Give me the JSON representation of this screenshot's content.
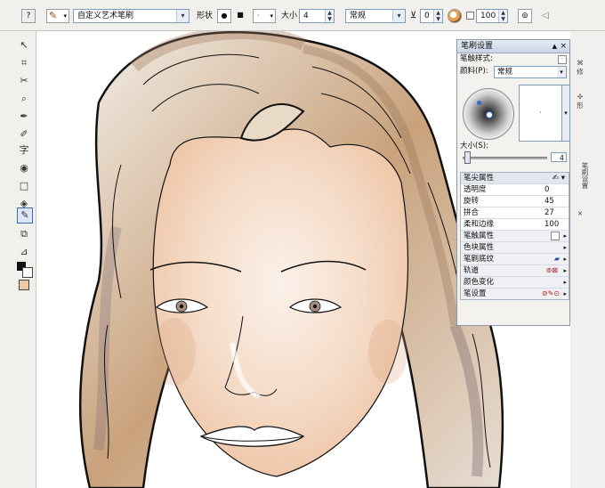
{
  "toolbar": {
    "brush_name": "自定义艺术笔刷",
    "shape_label": "形状",
    "size_label": "大小",
    "size_value": "4",
    "mode_value": "常规",
    "transparency_value": "0",
    "opacity_value": "100"
  },
  "panel": {
    "title": "笔刷设置",
    "nib_style_label": "笔触样式:",
    "paint_label": "颜料(P):",
    "paint_value": "常规",
    "size_label": "大小(S):",
    "size_value": "4",
    "nib_header": "笔尖属性",
    "properties": [
      {
        "label": "透明度",
        "value": "0"
      },
      {
        "label": "旋转",
        "value": "45"
      },
      {
        "label": "拼合",
        "value": "27"
      },
      {
        "label": "柔和边缘",
        "value": "100"
      }
    ],
    "sections": [
      {
        "label": "笔触属性"
      },
      {
        "label": "色块属性"
      },
      {
        "label": "笔刷底纹"
      },
      {
        "label": "轨道"
      },
      {
        "label": "颜色变化"
      },
      {
        "label": "笔设置"
      }
    ]
  },
  "right_tabs": [
    "修",
    "形",
    "笔刷设置"
  ],
  "colors": {
    "accent": "#2f6bd6",
    "panel_title": "#cfd9ea"
  }
}
